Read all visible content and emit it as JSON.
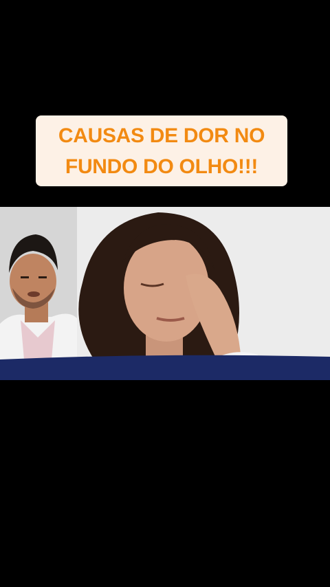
{
  "caption": {
    "text": "CAUSAS DE DOR NO FUNDO DO OLHO!!!"
  },
  "video": {
    "subjects": [
      "doctor-presenter",
      "woman-rubbing-eye"
    ]
  },
  "colors": {
    "background": "#000000",
    "caption_bg": "#fdf1e6",
    "caption_text": "#f28a12",
    "banner": "#1c2a66"
  }
}
